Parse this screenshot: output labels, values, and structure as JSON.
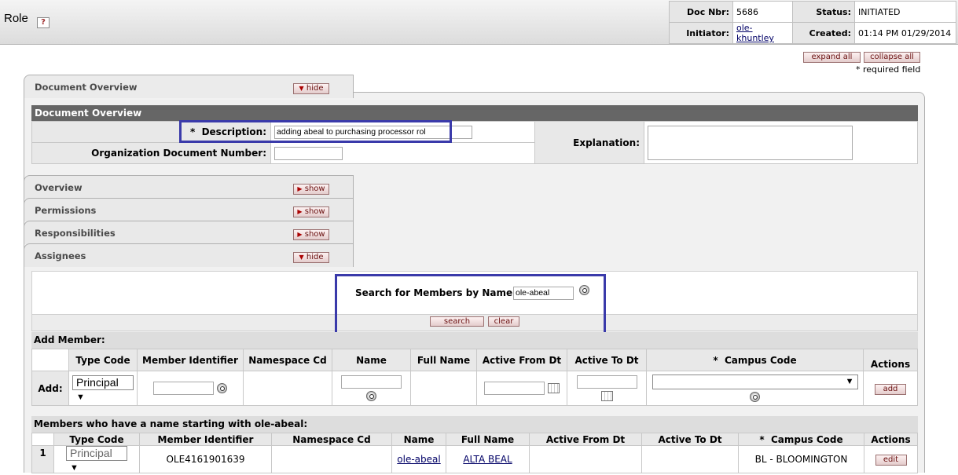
{
  "header": {
    "title": "Role",
    "help_icon": "?",
    "doc_nbr_label": "Doc Nbr:",
    "doc_nbr": "5686",
    "status_label": "Status:",
    "status": "INITIATED",
    "initiator_label": "Initiator:",
    "initiator": "ole-khuntley",
    "created_label": "Created:",
    "created": "01:14 PM 01/29/2014"
  },
  "controls": {
    "expand_all": "expand all",
    "collapse_all": "collapse all",
    "required_note": "* required field"
  },
  "tabs": {
    "document_overview": {
      "title": "Document Overview",
      "button": "hide"
    },
    "overview": {
      "title": "Overview",
      "button": "show"
    },
    "permissions": {
      "title": "Permissions",
      "button": "show"
    },
    "responsibilities": {
      "title": "Responsibilities",
      "button": "show"
    },
    "assignees": {
      "title": "Assignees",
      "button": "hide"
    }
  },
  "document_overview": {
    "section_title": "Document Overview",
    "description_label": "Description:",
    "description_required": "*",
    "description_value": "adding abeal to purchasing processor rol",
    "org_doc_number_label": "Organization Document Number:",
    "org_doc_number_value": "",
    "explanation_label": "Explanation:",
    "explanation_value": ""
  },
  "assignees": {
    "search_label": "Search for Members by Name:",
    "search_value": "ole-abeal",
    "search_button": "search",
    "clear_button": "clear",
    "add_member_title": "Add Member:",
    "columns": {
      "type_code": "Type Code",
      "member_identifier": "Member Identifier",
      "namespace_cd": "Namespace Cd",
      "name": "Name",
      "full_name": "Full Name",
      "active_from_dt": "Active From Dt",
      "active_to_dt": "Active To Dt",
      "campus_code": "Campus Code",
      "campus_required": "*",
      "actions": "Actions"
    },
    "add_row_label": "Add:",
    "add_type_code": "Principal",
    "add_button": "add",
    "members_title": "Members who have a name starting with ole-abeal:",
    "members": [
      {
        "index": "1",
        "type_code": "Principal",
        "member_identifier": "OLE4161901639",
        "namespace_cd": "",
        "name": "ole-abeal",
        "full_name": "ALTA BEAL",
        "active_from_dt": "",
        "active_to_dt": "",
        "campus_code": "BL - BLOOMINGTON",
        "action": "edit"
      }
    ]
  },
  "colors": {
    "section_header": "#666666",
    "highlight_box": "#3a3aaa",
    "button_text": "#6a1010"
  }
}
